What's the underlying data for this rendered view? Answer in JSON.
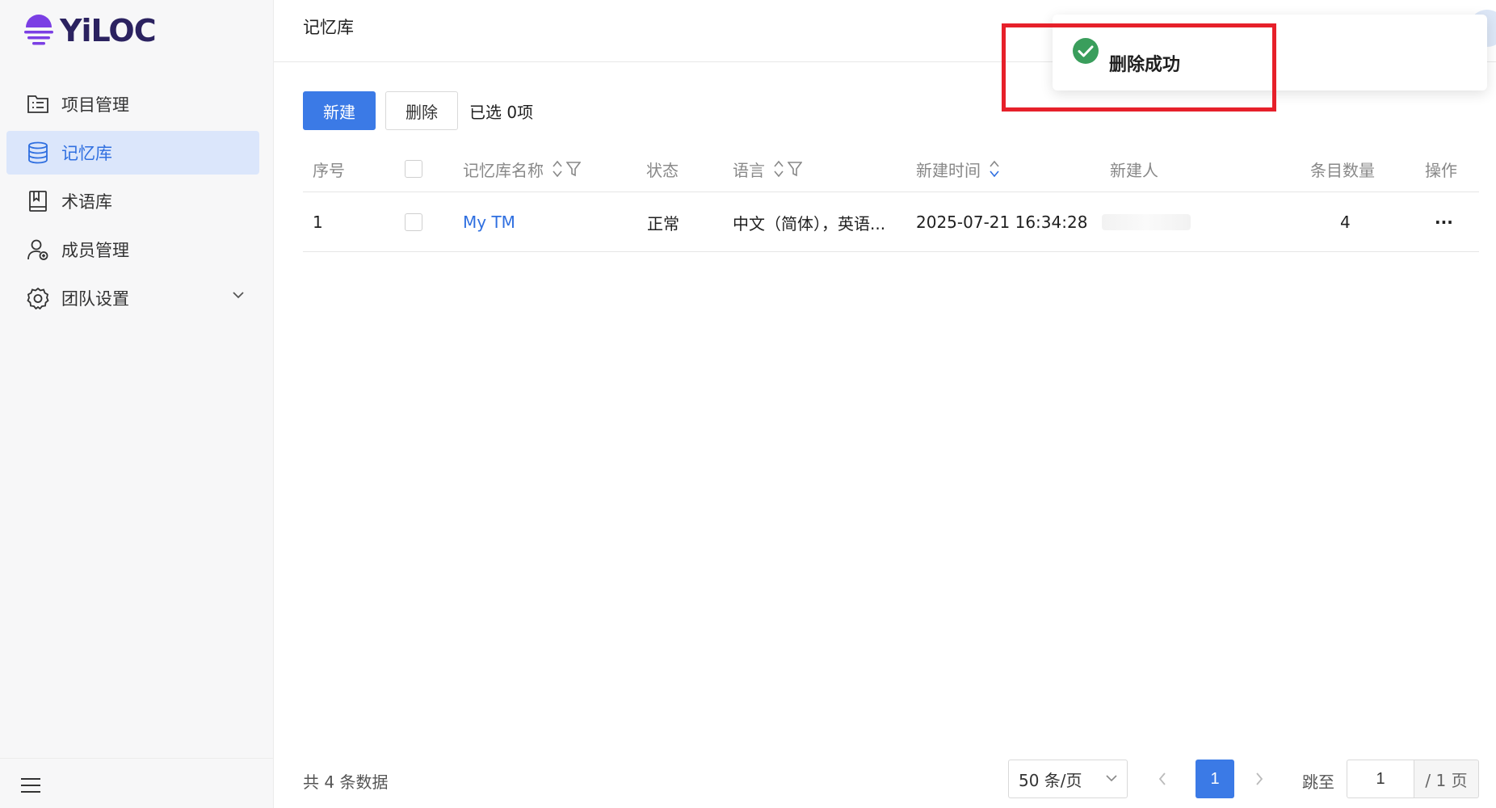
{
  "app": {
    "logo_text": "YiLOC"
  },
  "sidebar": {
    "items": [
      {
        "label": "项目管理",
        "icon": "project-list-icon"
      },
      {
        "label": "记忆库",
        "icon": "database-icon"
      },
      {
        "label": "术语库",
        "icon": "book-icon"
      },
      {
        "label": "成员管理",
        "icon": "member-icon"
      },
      {
        "label": "团队设置",
        "icon": "gear-icon"
      }
    ],
    "active_index": 1
  },
  "header": {
    "title": "记忆库"
  },
  "toolbar": {
    "new_label": "新建",
    "delete_label": "删除",
    "selected_text": "已选 0项"
  },
  "table": {
    "columns": {
      "index": "序号",
      "name": "记忆库名称",
      "status": "状态",
      "language": "语言",
      "created_time": "新建时间",
      "creator": "新建人",
      "count": "条目数量",
      "actions": "操作"
    },
    "rows": [
      {
        "index": "1",
        "name": "My TM",
        "status": "正常",
        "language": "中文（简体），英语...",
        "created_time": "2025-07-21 16:34:28",
        "count": "4",
        "actions": "···"
      }
    ]
  },
  "pagination": {
    "total_text": "共 4 条数据",
    "page_size": "50 条/页",
    "current_page": "1",
    "jump_label": "跳至",
    "jump_value": "1",
    "total_pages": "/ 1 页"
  },
  "toast": {
    "message": "删除成功",
    "type": "success"
  },
  "colors": {
    "primary": "#3b7ae6",
    "success": "#3a9e5c",
    "highlight": "#e6202a"
  }
}
